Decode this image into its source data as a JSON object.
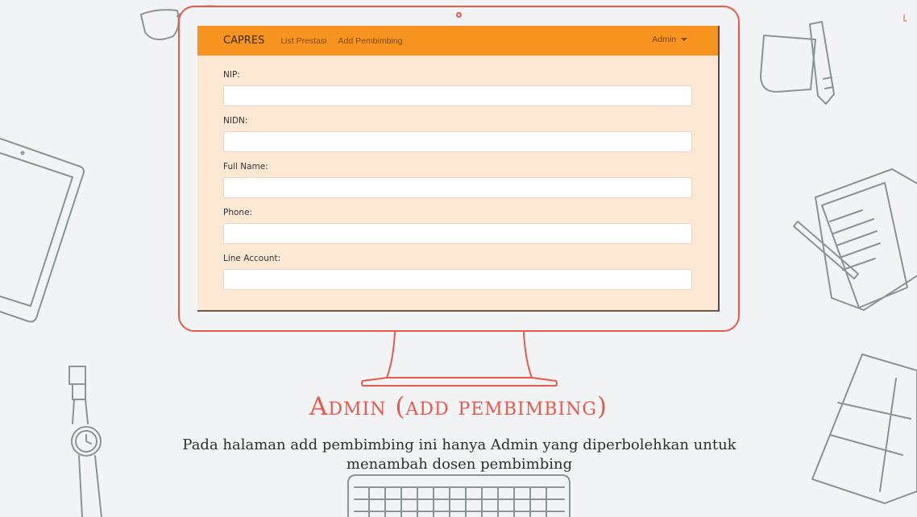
{
  "navbar": {
    "brand": "CAPRES",
    "links": [
      "List Prestasi",
      "Add Pembimbing"
    ],
    "user_menu": "Admin"
  },
  "form": {
    "fields": [
      {
        "label": "NIP:",
        "value": ""
      },
      {
        "label": "NIDN:",
        "value": ""
      },
      {
        "label": "Full Name:",
        "value": ""
      },
      {
        "label": "Phone:",
        "value": ""
      },
      {
        "label": "Line Account:",
        "value": ""
      }
    ]
  },
  "slide": {
    "title": "Admin (add pembimbing)",
    "description": "Pada halaman add pembimbing ini hanya Admin yang diperbolehkan untuk menambah dosen pembimbing"
  },
  "colors": {
    "accent": "#e8594a",
    "navbar": "#f7941f",
    "screen_bg": "#fde8d4",
    "page_bg": "#f2f3f4"
  }
}
